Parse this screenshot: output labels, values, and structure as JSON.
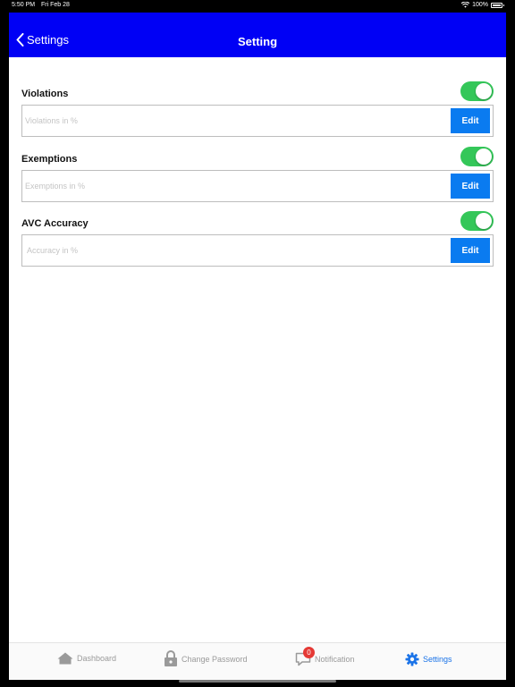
{
  "status_bar": {
    "time": "5:50 PM",
    "date": "Fri Feb 28",
    "battery": "100%"
  },
  "navbar": {
    "back_label": "Settings",
    "title": "Setting"
  },
  "sections": [
    {
      "label": "Violations",
      "toggle_on": true,
      "placeholder": "Violations in %",
      "value": "",
      "button": "Edit"
    },
    {
      "label": "Exemptions",
      "toggle_on": true,
      "placeholder": "Exemptions in %",
      "value": "",
      "button": "Edit"
    },
    {
      "label": "AVC Accuracy",
      "toggle_on": true,
      "placeholder": "Accuracy in %",
      "value": "",
      "button": "Edit"
    }
  ],
  "tabbar": {
    "items": [
      {
        "label": "Dashboard",
        "icon": "home-icon",
        "active": false
      },
      {
        "label": "Change Password",
        "icon": "lock-icon",
        "active": false
      },
      {
        "label": "Notification",
        "icon": "chat-bubble-icon",
        "badge": "0",
        "active": false
      },
      {
        "label": "Settings",
        "icon": "gear-icon",
        "active": true
      }
    ]
  },
  "colors": {
    "nav": "#0000f5",
    "toggle": "#34c759",
    "button": "#0a7bf0",
    "active_tab": "#1a73e8",
    "badge": "#e53935"
  }
}
